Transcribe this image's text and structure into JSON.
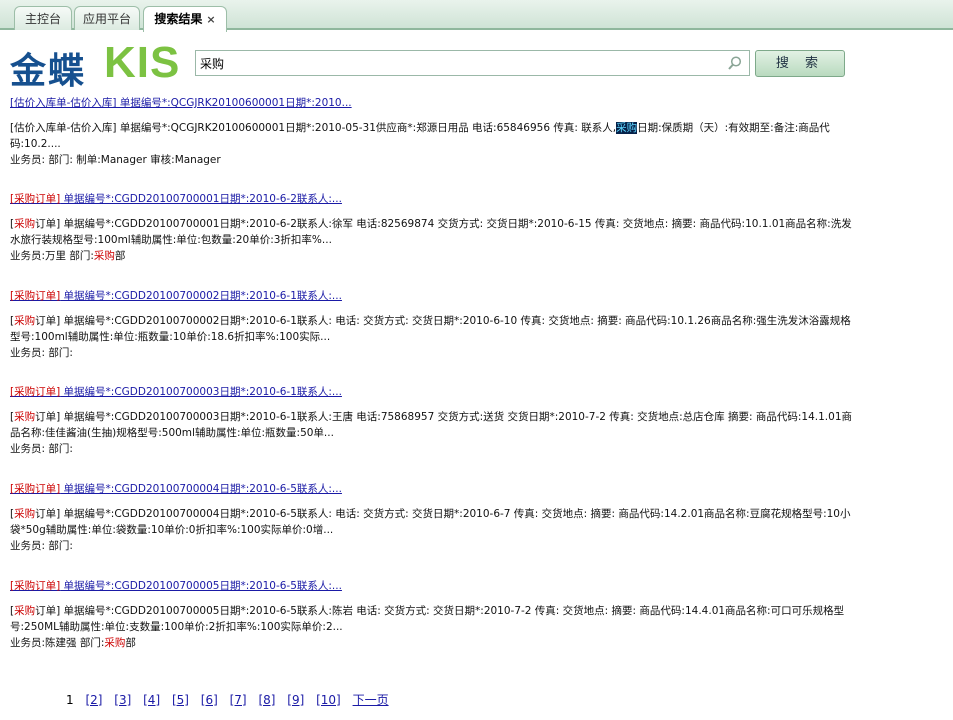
{
  "tabs": [
    {
      "label": "主控台"
    },
    {
      "label": "应用平台"
    },
    {
      "label": "搜索结果",
      "close": "×"
    }
  ],
  "logo": {
    "cn": "金蝶",
    "en": "KIS"
  },
  "search": {
    "value": "采购",
    "button_label": "搜 索"
  },
  "results": [
    {
      "title": "[估价入库单-估价入库] 单据编号*:QCGJRK20100600001日期*:2010...",
      "body_pre": "[估价入库单-估价入库] 单据编号*:QCGJRK20100600001日期*:2010-05-31供应商*:郑源日用品 电话:65846956 传真: 联系人,",
      "body_hl": "采购",
      "body_post": "日期:保质期（天）:有效期至:备注:商品代码:10.2....",
      "line2_pre": "业务员: 部门: 制单:Manager 审核:Manager",
      "line2_hl": "",
      "line2_post": ""
    },
    {
      "title_hl": "[采购订单]",
      "title": " 单据编号*:CGDD20100700001日期*:2010-6-2联系人:...",
      "body_open": "[",
      "body_hl": "采购",
      "body_rest": "订单] 单据编号*:CGDD20100700001日期*:2010-6-2联系人:徐军 电话:82569874 交货方式: 交货日期*:2010-6-15 传真: 交货地点: 摘要: 商品代码:10.1.01商品名称:洗发水旅行装规格型号:100ml辅助属性:单位:包数量:20单价:3折扣率%...",
      "line2_pre": "业务员:万里 部门:",
      "line2_hl": "采购",
      "line2_post": "部"
    },
    {
      "title_hl": "[采购订单]",
      "title": " 单据编号*:CGDD20100700002日期*:2010-6-1联系人:...",
      "body_open": "[",
      "body_hl": "采购",
      "body_rest": "订单] 单据编号*:CGDD20100700002日期*:2010-6-1联系人: 电话: 交货方式: 交货日期*:2010-6-10 传真: 交货地点: 摘要: 商品代码:10.1.26商品名称:强生洗发沐浴露规格型号:100ml辅助属性:单位:瓶数量:10单价:18.6折扣率%:100实际...",
      "line2_pre": "业务员: 部门:",
      "line2_hl": "",
      "line2_post": ""
    },
    {
      "title_hl": "[采购订单]",
      "title": " 单据编号*:CGDD20100700003日期*:2010-6-1联系人:...",
      "body_open": "[",
      "body_hl": "采购",
      "body_rest": "订单] 单据编号*:CGDD20100700003日期*:2010-6-1联系人:王唐 电话:75868957 交货方式:送货 交货日期*:2010-7-2 传真: 交货地点:总店仓库 摘要: 商品代码:14.1.01商品名称:佳佳酱油(生抽)规格型号:500ml辅助属性:单位:瓶数量:50单...",
      "line2_pre": "业务员: 部门:",
      "line2_hl": "",
      "line2_post": ""
    },
    {
      "title_hl": "[采购订单]",
      "title": " 单据编号*:CGDD20100700004日期*:2010-6-5联系人:...",
      "body_open": "[",
      "body_hl": "采购",
      "body_rest": "订单] 单据编号*:CGDD20100700004日期*:2010-6-5联系人: 电话: 交货方式: 交货日期*:2010-6-7 传真: 交货地点: 摘要: 商品代码:14.2.01商品名称:豆腐花规格型号:10小袋*50g辅助属性:单位:袋数量:10单价:0折扣率%:100实际单价:0增...",
      "line2_pre": "业务员: 部门:",
      "line2_hl": "",
      "line2_post": ""
    },
    {
      "title_hl": "[采购订单]",
      "title": " 单据编号*:CGDD20100700005日期*:2010-6-5联系人:...",
      "body_open": "[",
      "body_hl": "采购",
      "body_rest": "订单] 单据编号*:CGDD20100700005日期*:2010-6-5联系人:陈岩 电话: 交货方式: 交货日期*:2010-7-2 传真: 交货地点: 摘要: 商品代码:14.4.01商品名称:可口可乐规格型号:250ML辅助属性:单位:支数量:100单价:2折扣率%:100实际单价:2...",
      "line2_pre": "业务员:陈建强 部门:",
      "line2_hl": "采购",
      "line2_post": "部"
    }
  ],
  "pager": {
    "current": "1",
    "pages": [
      "[2]",
      "[3]",
      "[4]",
      "[5]",
      "[6]",
      "[7]",
      "[8]",
      "[9]",
      "[10]"
    ],
    "next": "下一页"
  }
}
